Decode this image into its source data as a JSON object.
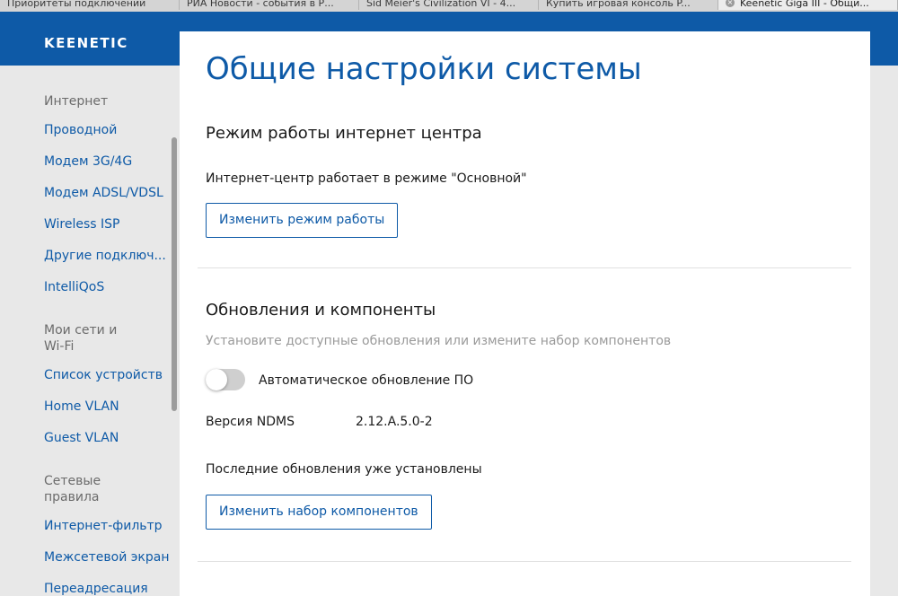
{
  "browser": {
    "tabs": [
      {
        "label": "Приоритеты подключений",
        "active": false
      },
      {
        "label": "РИА Новости - события в Р...",
        "active": false
      },
      {
        "label": "Sid Meier's Civilization VI - 4...",
        "active": false
      },
      {
        "label": "Купить игровая консоль P...",
        "active": false
      },
      {
        "label": "Keenetic Giga III - Общи...",
        "active": true
      }
    ],
    "close_glyph": "×"
  },
  "header": {
    "logo": "KEENETIC"
  },
  "sidebar": {
    "groups": [
      {
        "label": "Интернет",
        "items": [
          "Проводной",
          "Модем 3G/4G",
          "Модем ADSL/VDSL",
          "Wireless ISP",
          "Другие подключ...",
          "IntelliQoS"
        ]
      },
      {
        "label": "Мои сети и\nWi-Fi",
        "items": [
          "Список устройств",
          "Home VLAN",
          "Guest VLAN"
        ]
      },
      {
        "label": "Сетевые\nправила",
        "items": [
          "Интернет-фильтр",
          "Межсетевой экран",
          "Переадресация"
        ]
      }
    ]
  },
  "main": {
    "title": "Общие настройки системы",
    "mode_section": {
      "title": "Режим работы интернет центра",
      "status": "Интернет-центр работает в режиме \"Основной\"",
      "change_button": "Изменить режим работы"
    },
    "updates_section": {
      "title": "Обновления и компоненты",
      "subtitle": "Установите доступные обновления или измените набор компонентов",
      "auto_update_label": "Автоматическое обновление ПО",
      "auto_update_enabled": false,
      "version_label": "Версия NDMS",
      "version_value": "2.12.A.5.0-2",
      "status": "Последние обновления уже установлены",
      "components_button": "Изменить набор компонентов"
    }
  },
  "colors": {
    "brand_blue": "#0e5aa7",
    "sidebar_bg": "#e8e8e8",
    "muted_text": "#9a9a9a"
  }
}
